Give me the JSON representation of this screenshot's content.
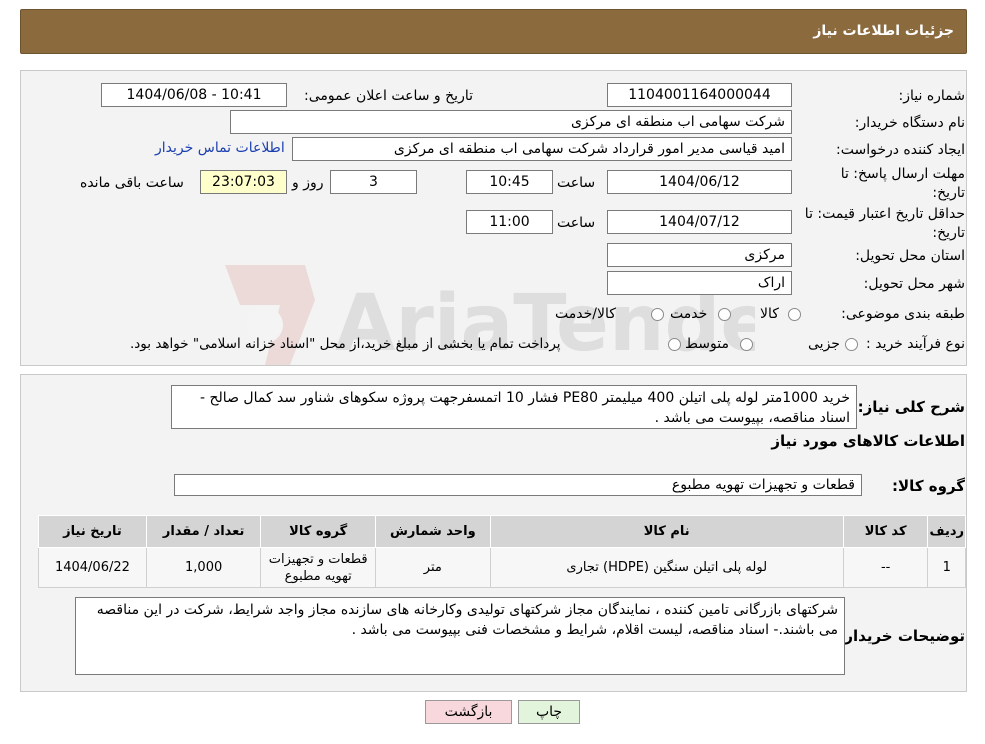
{
  "header": {
    "title": "جزئیات اطلاعات نیاز"
  },
  "form": {
    "need_number_label": "شماره نیاز:",
    "need_number": "1104001164000044",
    "announce_label": "تاریخ و ساعت اعلان عمومی:",
    "announce_value": "1404/06/08 - 10:41",
    "buyer_org_label": "نام دستگاه خریدار:",
    "buyer_org": "شرکت سهامی اب منطقه ای مرکزی",
    "creator_label": "ایجاد کننده درخواست:",
    "creator": "امید قیاسی مدیر امور قرارداد شرکت سهامی اب منطقه ای مرکزی",
    "contact_link": "اطلاعات تماس خریدار",
    "deadline_label_1": "مهلت ارسال پاسخ: تا",
    "deadline_label_2": "تاریخ:",
    "deadline_date": "1404/06/12",
    "time_label": "ساعت",
    "deadline_time": "10:45",
    "days_value": "3",
    "days_label": "روز و",
    "remaining_time": "23:07:03",
    "remaining_label": "ساعت باقی مانده",
    "validity_label_1": "حداقل تاریخ اعتبار قیمت: تا",
    "validity_label_2": "تاریخ:",
    "validity_date": "1404/07/12",
    "validity_time": "11:00",
    "province_label": "استان محل تحویل:",
    "province": "مرکزی",
    "city_label": "شهر محل تحویل:",
    "city": "اراک",
    "category_label": "طبقه بندی موضوعی:",
    "category_options": [
      "کالا",
      "خدمت",
      "کالا/خدمت"
    ],
    "process_label": "نوع فرآیند خرید :",
    "process_options": [
      "جزیی",
      "متوسط"
    ],
    "process_note": "پرداخت تمام یا بخشی از مبلغ خرید،از محل \"اسناد خزانه اسلامی\" خواهد بود."
  },
  "description": {
    "label": "شرح کلی نیاز:",
    "text": "خرید 1000متر لوله پلی اتیلن 400 میلیمتر PE80 فشار 10 اتمسفرجهت پروژه سکوهای شناور سد کمال صالح - اسناد مناقصه، بپیوست می باشد ."
  },
  "goods_section": {
    "title": "اطلاعات کالاهای مورد نیاز"
  },
  "goods_group": {
    "label": "گروه کالا:",
    "value": "قطعات و تجهیزات تهویه مطبوع"
  },
  "table": {
    "headers": [
      "ردیف",
      "کد کالا",
      "نام کالا",
      "واحد شمارش",
      "گروه کالا",
      "تعداد / مقدار",
      "تاریخ نیاز"
    ],
    "rows": [
      [
        "1",
        "--",
        "لوله پلی اتیلن سنگین (HDPE) تجاری",
        "متر",
        "قطعات و تجهیزات تهویه مطبوع",
        "1,000",
        "1404/06/22"
      ]
    ]
  },
  "buyer_notes": {
    "label": "توضیحات خریدار:",
    "text": "شرکتهای بازرگانی تامین کننده ، نمایندگان مجاز شرکتهای تولیدی وکارخانه های سازنده مجاز واجد شرایط، شرکت در این مناقصه می باشند.- اسناد مناقصه، لیست اقلام، شرایط و مشخصات فنی بپیوست می باشد ."
  },
  "buttons": {
    "print": "چاپ",
    "back": "بازگشت"
  },
  "watermark": {
    "text": "AriaTender.neT"
  },
  "colors": {
    "header": "#8b6a3e",
    "link": "#1a3fb0",
    "back_button": "#f8d8dc",
    "print_button": "#e2f4dc",
    "remaining_box": "#ffffcc"
  }
}
